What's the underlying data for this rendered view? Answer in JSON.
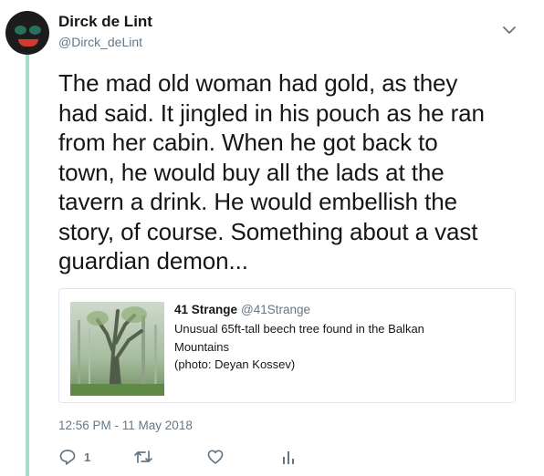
{
  "author": {
    "name": "Dirck de Lint",
    "handle": "@Dirck_deLint"
  },
  "tweet": {
    "text": "The mad old woman had gold, as they\nhad said. It jingled in his pouch as he ran\nfrom her cabin. When he got back to\ntown, he would buy all the lads at the\ntavern a drink. He would embellish the\nstory, of course. Something about a vast\nguardian demon...",
    "timestamp": "12:56 PM - 11 May 2018"
  },
  "quoted": {
    "name": "41 Strange",
    "handle": "@41Strange",
    "text": "Unusual 65ft-tall beech tree found in the Balkan\nMountains\n(photo: Deyan Kossev)"
  },
  "actions": {
    "reply_count": "1"
  },
  "icons": {
    "menu": "chevron-down-icon",
    "reply": "reply-icon",
    "retweet": "retweet-icon",
    "like": "heart-icon",
    "analytics": "analytics-icon"
  },
  "colors": {
    "thread_line": "#a6dcc8",
    "muted": "#657786",
    "text": "#14171a",
    "icon": "#657786"
  }
}
